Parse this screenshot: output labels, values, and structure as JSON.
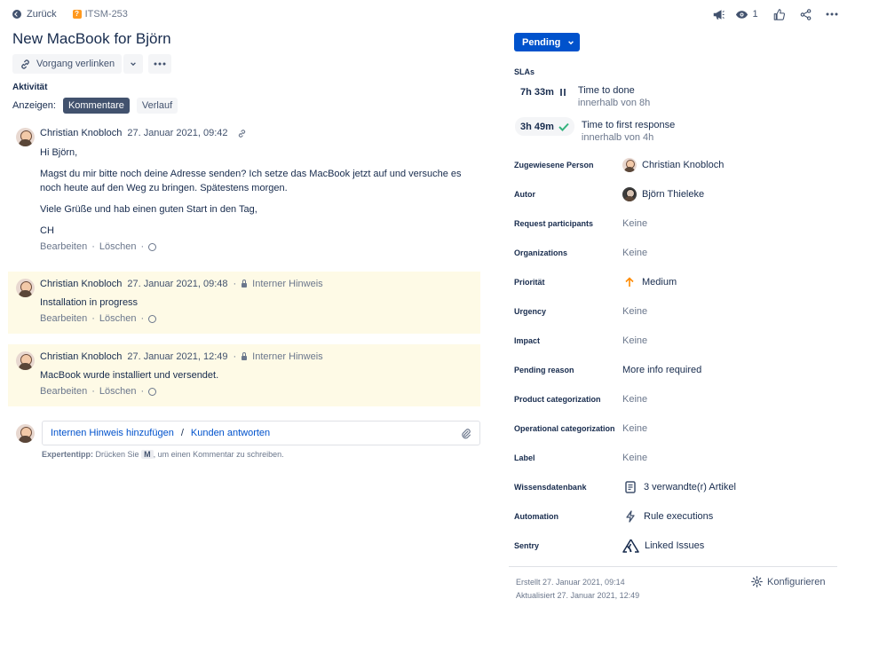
{
  "header": {
    "back_label": "Zurück",
    "issue_key": "ITSM-253",
    "title": "New MacBook for Björn",
    "watch_count": "1"
  },
  "toolbar": {
    "link_issue_label": "Vorgang verlinken"
  },
  "activity": {
    "section_label": "Aktivität",
    "show_label": "Anzeigen:",
    "tabs": [
      "Kommentare",
      "Verlauf"
    ]
  },
  "comments": [
    {
      "author": "Christian Knobloch",
      "date": "27. Januar 2021, 09:42",
      "internal_label": "",
      "body": [
        "Hi Björn,",
        "Magst du mir bitte noch deine Adresse senden? Ich setze das MacBook jetzt auf und versuche es noch heute auf den Weg zu bringen. Spätestens morgen.",
        "Viele Grüße und hab einen guten Start in den Tag,",
        "CH"
      ]
    },
    {
      "author": "Christian Knobloch",
      "date": "27. Januar 2021, 09:48",
      "internal_label": "Interner Hinweis",
      "body": [
        "Installation in progress"
      ]
    },
    {
      "author": "Christian Knobloch",
      "date": "27. Januar 2021, 12:49",
      "internal_label": "Interner Hinweis",
      "body": [
        "MacBook wurde installiert und versendet."
      ]
    }
  ],
  "comment_actions": {
    "edit": "Bearbeiten",
    "delete": "Löschen"
  },
  "reply": {
    "internal_note": "Internen Hinweis hinzufügen",
    "separator": "/",
    "reply_customer": "Kunden antworten",
    "tip_label": "Expertentipp:",
    "tip_pre": "Drücken Sie",
    "tip_key": "M",
    "tip_post": ", um einen Kommentar zu schreiben."
  },
  "status": {
    "label": "Pending"
  },
  "slas": {
    "label": "SLAs",
    "items": [
      {
        "time": "7h 33m",
        "title": "Time to done",
        "sub": "innerhalb von 8h",
        "state": "paused"
      },
      {
        "time": "3h 49m",
        "title": "Time to first response",
        "sub": "innerhalb von 4h",
        "state": "met"
      }
    ]
  },
  "fields": [
    {
      "label": "Zugewiesene Person",
      "value": "Christian Knobloch",
      "icon": "avatar"
    },
    {
      "label": "Autor",
      "value": "Björn Thieleke",
      "icon": "avatar-dark"
    },
    {
      "label": "Request participants",
      "value": "Keine",
      "icon": ""
    },
    {
      "label": "Organizations",
      "value": "Keine",
      "icon": ""
    },
    {
      "label": "Priorität",
      "value": "Medium",
      "icon": "arrow-up-icon"
    },
    {
      "label": "Urgency",
      "value": "Keine",
      "icon": ""
    },
    {
      "label": "Impact",
      "value": "Keine",
      "icon": ""
    },
    {
      "label": "Pending reason",
      "value": "More info required",
      "icon": ""
    },
    {
      "label": "Product categorization",
      "value": "Keine",
      "icon": ""
    },
    {
      "label": "Operational categorization",
      "value": "Keine",
      "icon": ""
    },
    {
      "label": "Label",
      "value": "Keine",
      "icon": ""
    },
    {
      "label": "Wissensdatenbank",
      "value": "3 verwandte(r) Artikel",
      "icon": "document-icon"
    },
    {
      "label": "Automation",
      "value": "Rule executions",
      "icon": "lightning-icon"
    },
    {
      "label": "Sentry",
      "value": "Linked Issues",
      "icon": "sentry-icon"
    }
  ],
  "meta": {
    "created": "Erstellt 27. Januar 2021, 09:14",
    "updated": "Aktualisiert 27. Januar 2021, 12:49",
    "configure": "Konfigurieren"
  },
  "colors": {
    "primary": "#0052cc",
    "internal_bg": "#fefae6",
    "priority_medium": "#ff8b00",
    "sla_met": "#36b37e"
  }
}
